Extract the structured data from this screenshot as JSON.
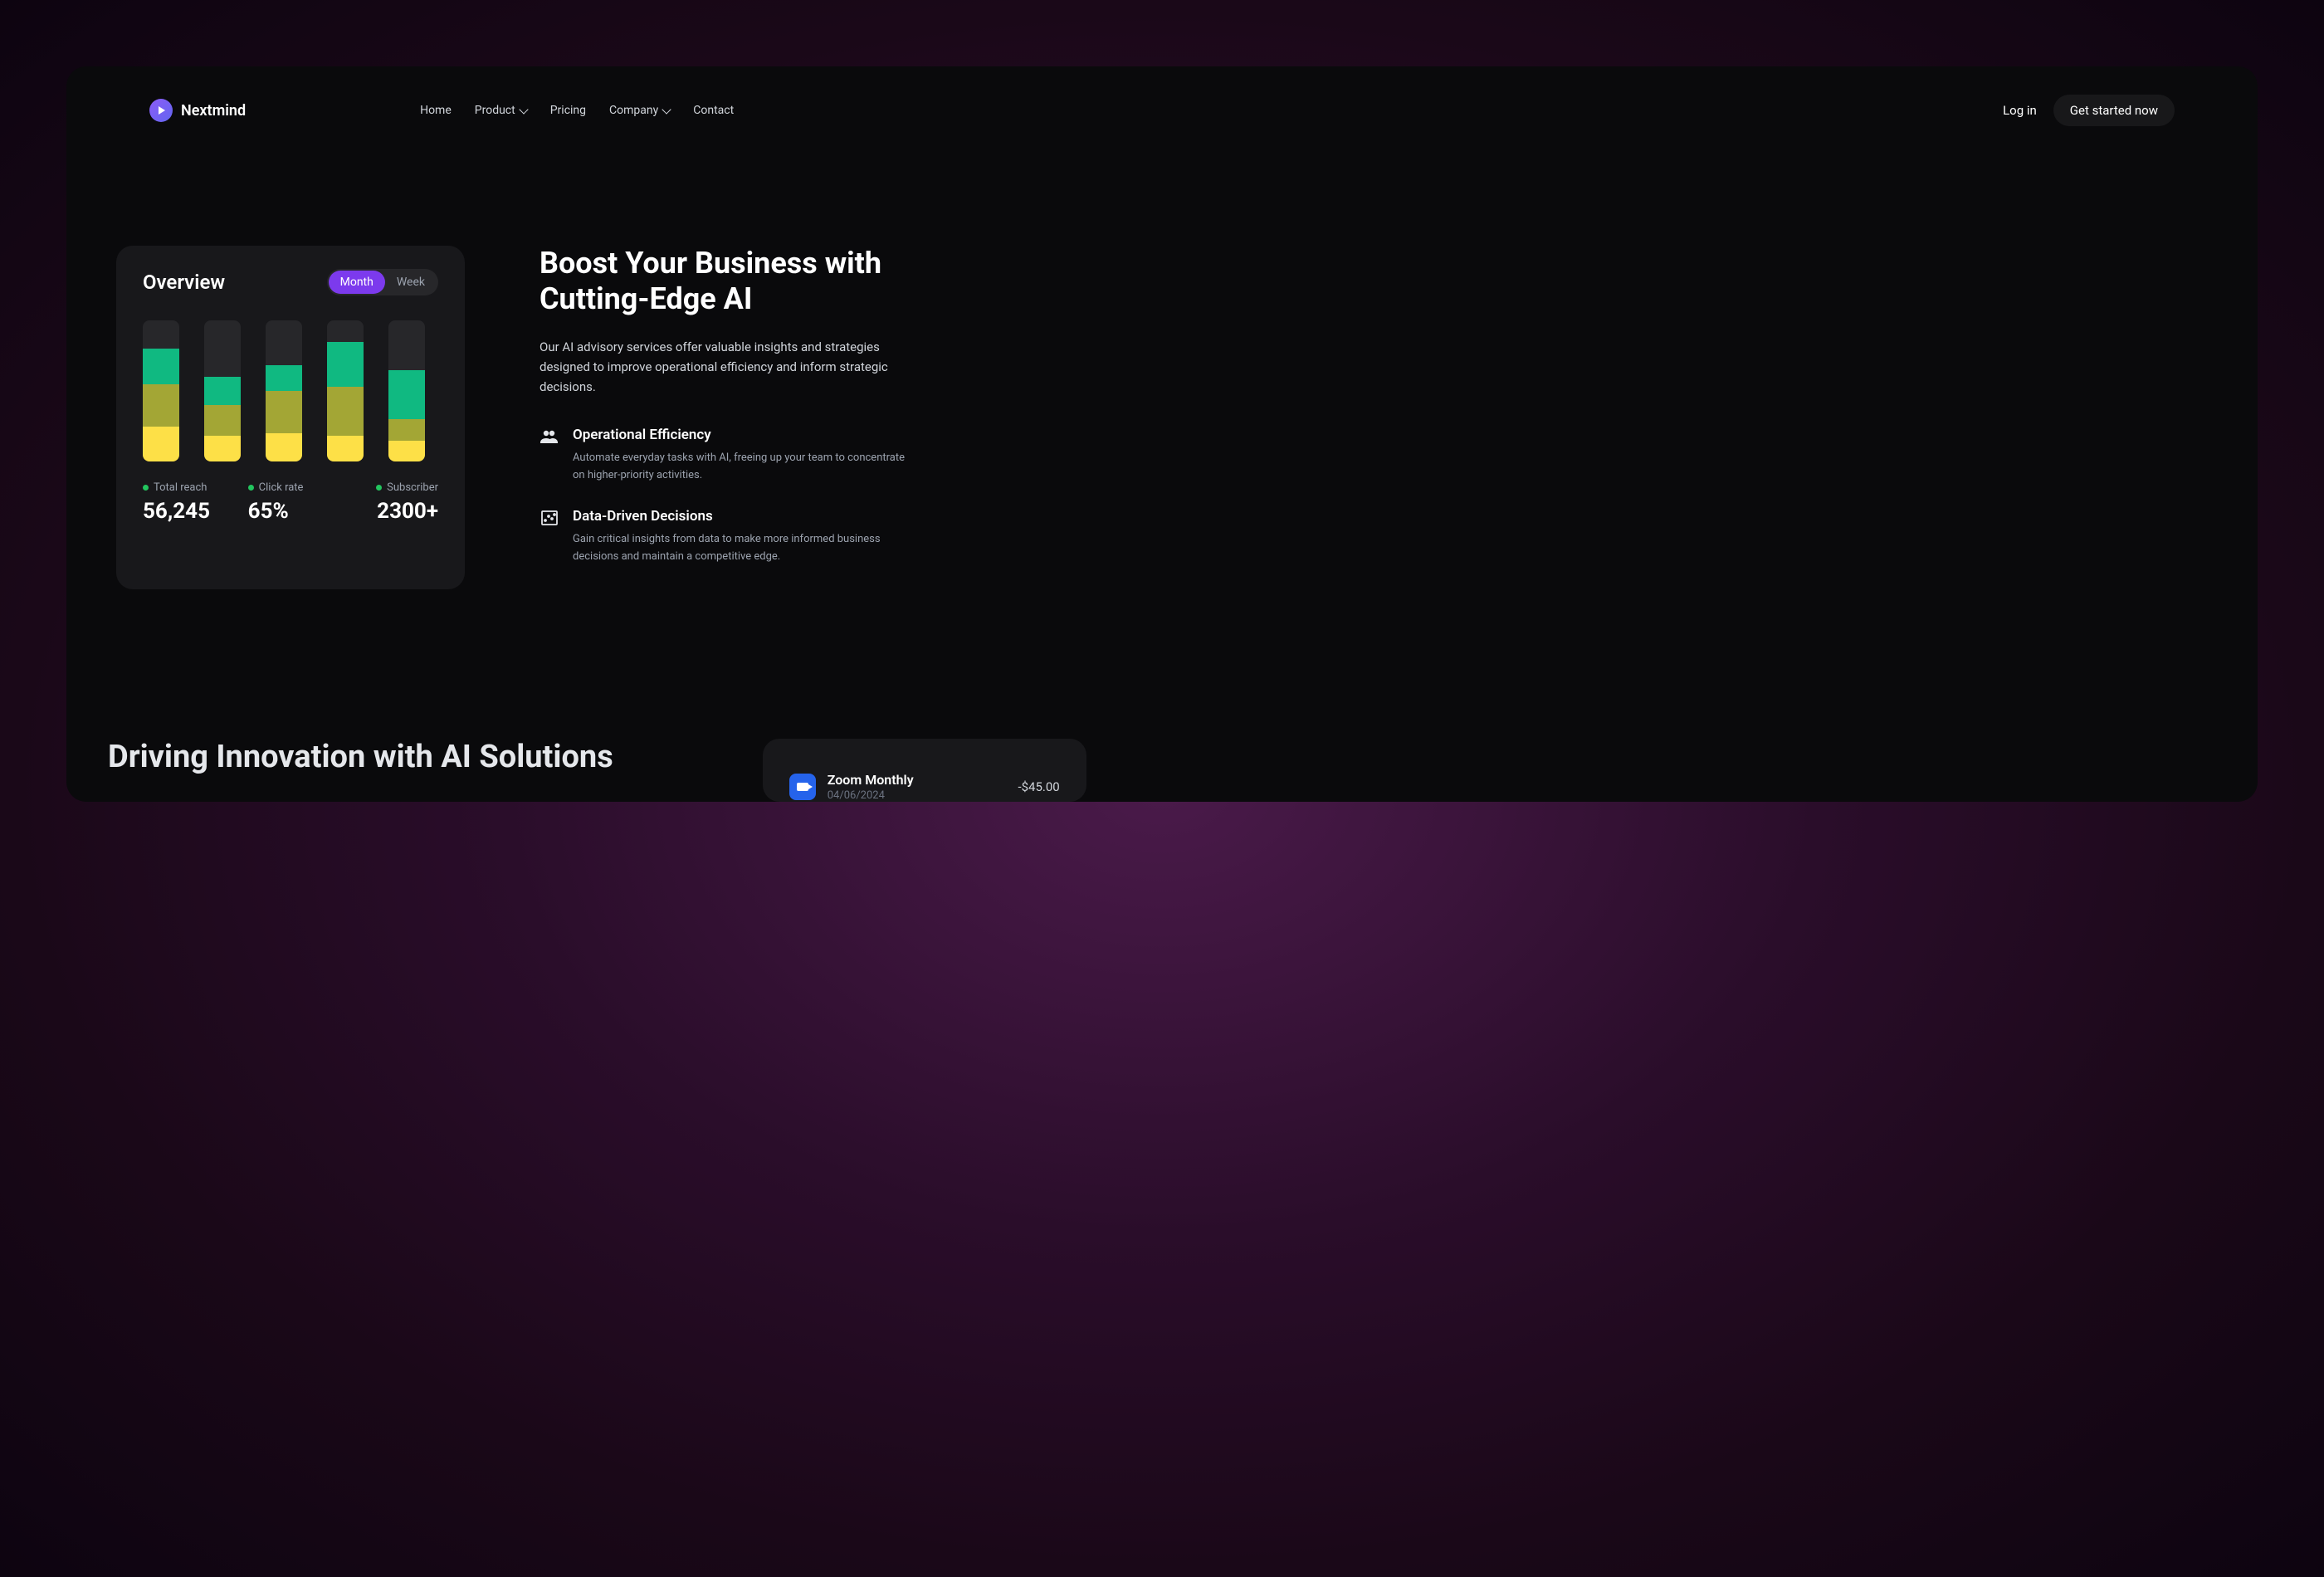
{
  "brand": {
    "name": "Nextmind"
  },
  "nav": {
    "home": "Home",
    "product": "Product",
    "pricing": "Pricing",
    "company": "Company",
    "contact": "Contact"
  },
  "actions": {
    "login": "Log in",
    "cta": "Get started now"
  },
  "overview": {
    "title": "Overview",
    "toggle": {
      "month": "Month",
      "week": "Week"
    },
    "stats": [
      {
        "label": "Total reach",
        "value": "56,245"
      },
      {
        "label": "Click rate",
        "value": "65%"
      },
      {
        "label": "Subscriber",
        "value": "2300+"
      }
    ]
  },
  "hero": {
    "headline": "Boost Your Business with Cutting-Edge AI",
    "subhead": "Our AI advisory services offer valuable insights and strategies designed to improve operational efficiency and inform strategic decisions.",
    "features": [
      {
        "title": "Operational Efficiency",
        "desc": "Automate everyday tasks with AI, freeing up your team to concentrate on higher-priority activities."
      },
      {
        "title": "Data-Driven Decisions",
        "desc": "Gain critical insights from data to make more informed business decisions and maintain a competitive edge."
      }
    ]
  },
  "section2": {
    "headline": "Driving Innovation with AI Solutions",
    "transaction": {
      "name": "Zoom Monthly",
      "date": "04/06/2024",
      "amount": "-$45.00"
    }
  },
  "chart_data": {
    "type": "bar",
    "note": "stacked bars, percentage heights of teal/olive/yellow segments per column",
    "columns": [
      {
        "teal": 25,
        "olive": 30,
        "yellow": 25
      },
      {
        "teal": 20,
        "olive": 22,
        "yellow": 18
      },
      {
        "teal": 18,
        "olive": 30,
        "yellow": 20
      },
      {
        "teal": 32,
        "olive": 35,
        "yellow": 18
      },
      {
        "teal": 35,
        "olive": 15,
        "yellow": 15
      }
    ]
  }
}
